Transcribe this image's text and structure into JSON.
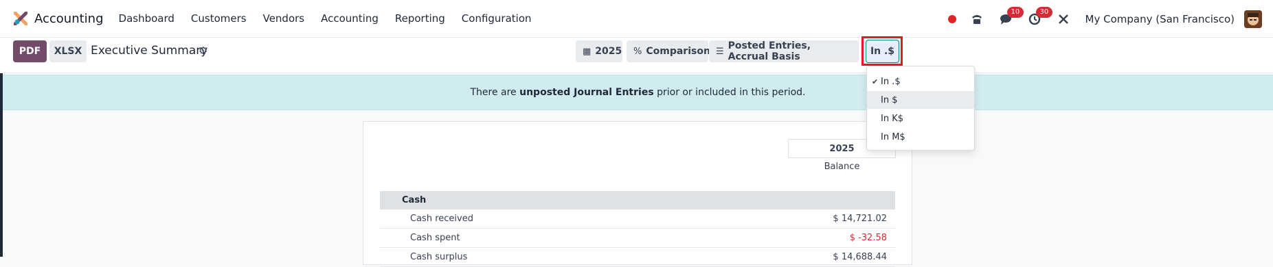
{
  "navbar": {
    "app_name": "Accounting",
    "menu": [
      "Dashboard",
      "Customers",
      "Vendors",
      "Accounting",
      "Reporting",
      "Configuration"
    ],
    "messages_badge": "10",
    "activities_badge": "30",
    "company": "My Company (San Francisco)"
  },
  "controls": {
    "pdf_label": "PDF",
    "xlsx_label": "XLSX",
    "report_title": "Executive Summary",
    "year_filter": "2025",
    "comparison_filter": "Comparison",
    "posted_filter": "Posted Entries, Accrual Basis",
    "unit_filter": "In .$"
  },
  "alert": {
    "prefix": "There are ",
    "bold": "unposted Journal Entries",
    "suffix": " prior or included in this period."
  },
  "report": {
    "column_header": "2025",
    "column_sub": "Balance",
    "section": "Cash",
    "rows": [
      {
        "label": "Cash received",
        "value": "$ 14,721.02"
      },
      {
        "label": "Cash spent",
        "value": "$ -32.58"
      },
      {
        "label": "Cash surplus",
        "value": "$ 14,688.44"
      }
    ]
  },
  "unit_dropdown": {
    "options": [
      "In .$",
      "In $",
      "In K$",
      "In M$"
    ],
    "selected": "In .$",
    "hovered": "In $"
  },
  "colors": {
    "brand": "#714b67",
    "alert_bg": "#d1ecf1",
    "negative": "#d42b35",
    "highlight": "#e01b24"
  }
}
